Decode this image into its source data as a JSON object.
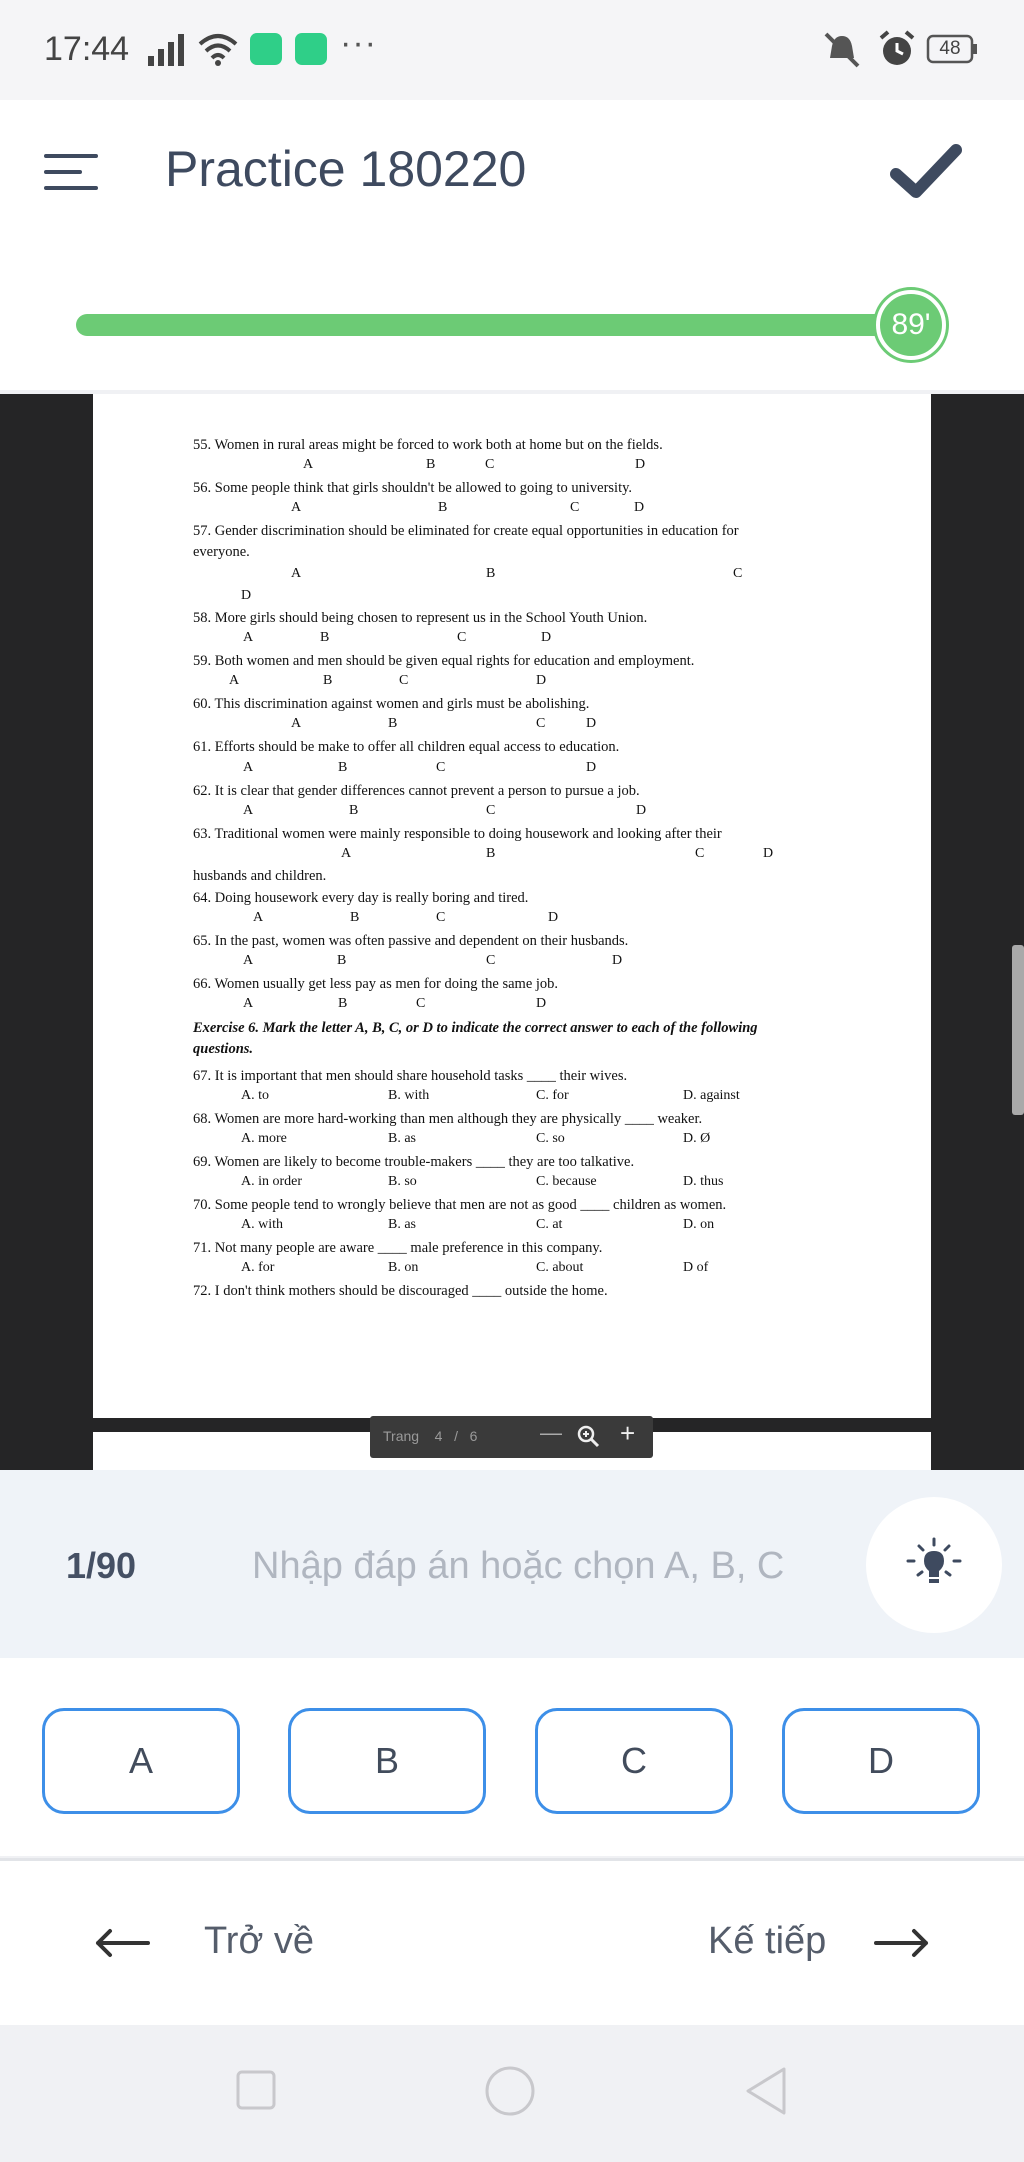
{
  "status_bar": {
    "time": "17:44",
    "more": "···",
    "battery": "48",
    "icons": [
      "signal-icon",
      "wifi-icon",
      "app-icon",
      "chat-icon",
      "mute-icon",
      "alarm-icon",
      "battery-icon"
    ]
  },
  "header": {
    "title": "Practice 180220"
  },
  "timer": {
    "label": "89'",
    "progress_fraction": 0.98
  },
  "pdf": {
    "lines": {
      "q55": "55. Women in rural areas might be forced to work both at home but on the fields.",
      "q56": "56. Some people think that girls shouldn't be allowed to going to university.",
      "q57a": "57. Gender discrimination should be eliminated for create equal opportunities in education for",
      "q57b": "everyone.",
      "q58": "58. More girls should being chosen to represent us in the School Youth Union.",
      "q59": "59. Both women and men should be given equal rights for education and employment.",
      "q60": "60. This discrimination against women and girls must be abolishing.",
      "q61": "61. Efforts should be make to offer all children equal access to education.",
      "q62": "62. It is clear that gender differences cannot prevent a person to pursue a job.",
      "q63a": "63. Traditional women were mainly responsible to doing housework and looking after their",
      "q63b": "husbands and children.",
      "q64": "64. Doing housework every day is really boring and tired.",
      "q65": "65. In the past, women was often passive and dependent on their husbands.",
      "q66": "66. Women usually get less pay as men for doing the same job.",
      "ex6a": "Exercise 6. Mark the letter A, B, C, or D to indicate the correct answer to each of the following",
      "ex6b": "questions.",
      "q67": "67.   It is important that men should share household tasks ____ their wives.",
      "q67_opts": [
        "A. to",
        "B. with",
        "C. for",
        "D. against"
      ],
      "q68": "68. Women are more hard-working than men although they are physically ____ weaker.",
      "q68_opts": [
        "A. more",
        "B. as",
        "C. so",
        "D. Ø"
      ],
      "q69": "69. Women are likely to become trouble-makers ____ they are too talkative.",
      "q69_opts": [
        "A. in order",
        "B. so",
        "C. because",
        "D. thus"
      ],
      "q70": "70. Some people tend to wrongly believe that men are not as good ____ children as women.",
      "q70_opts": [
        "A. with",
        "B. as",
        "C. at",
        "D. on"
      ],
      "q71": "71. Not many people are aware ____ male preference in this company.",
      "q71_opts": [
        "A. for",
        "B. on",
        "C. about",
        "D of"
      ],
      "q72": "72. I don't think mothers should be discouraged ____ outside the home."
    },
    "toolbar": {
      "page_label": "Trang",
      "current": "4",
      "sep": "/",
      "total": "6",
      "minus": "—",
      "plus": "+"
    }
  },
  "answer": {
    "counter": "1/90",
    "placeholder": "Nhập đáp án hoặc chọn A, B, C"
  },
  "options": [
    "A",
    "B",
    "C",
    "D"
  ],
  "nav": {
    "back": "Trở về",
    "next": "Kế tiếp"
  },
  "colors": {
    "accent_green": "#6ccb75",
    "option_border": "#3d8fe8",
    "title": "#3e4a5f"
  }
}
